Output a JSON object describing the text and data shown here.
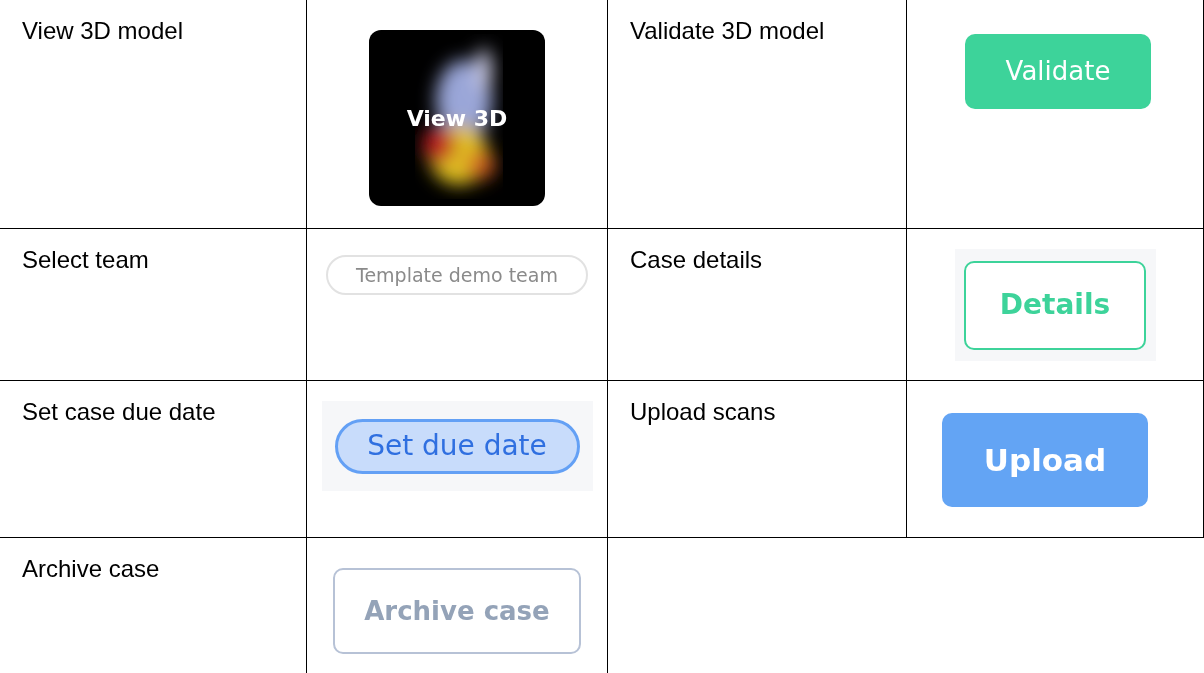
{
  "rows": [
    {
      "cells": [
        {
          "label": "View 3D model",
          "control": {
            "kind": "thumbnail",
            "text": "View 3D"
          }
        },
        {
          "label": "Validate 3D model",
          "control": {
            "kind": "solid-green",
            "text": "Validate"
          }
        }
      ]
    },
    {
      "cells": [
        {
          "label": "Select team",
          "control": {
            "kind": "pill-outline",
            "text": "Template demo team"
          }
        },
        {
          "label": "Case details",
          "control": {
            "kind": "outline-green",
            "text": "Details"
          }
        }
      ]
    },
    {
      "cells": [
        {
          "label": "Set case due date",
          "control": {
            "kind": "pill-blue",
            "text": "Set due date"
          }
        },
        {
          "label": "Upload scans",
          "control": {
            "kind": "solid-blue",
            "text": "Upload"
          }
        }
      ]
    },
    {
      "cells": [
        {
          "label": "Archive case",
          "control": {
            "kind": "outline-gray",
            "text": "Archive case"
          }
        }
      ]
    }
  ]
}
